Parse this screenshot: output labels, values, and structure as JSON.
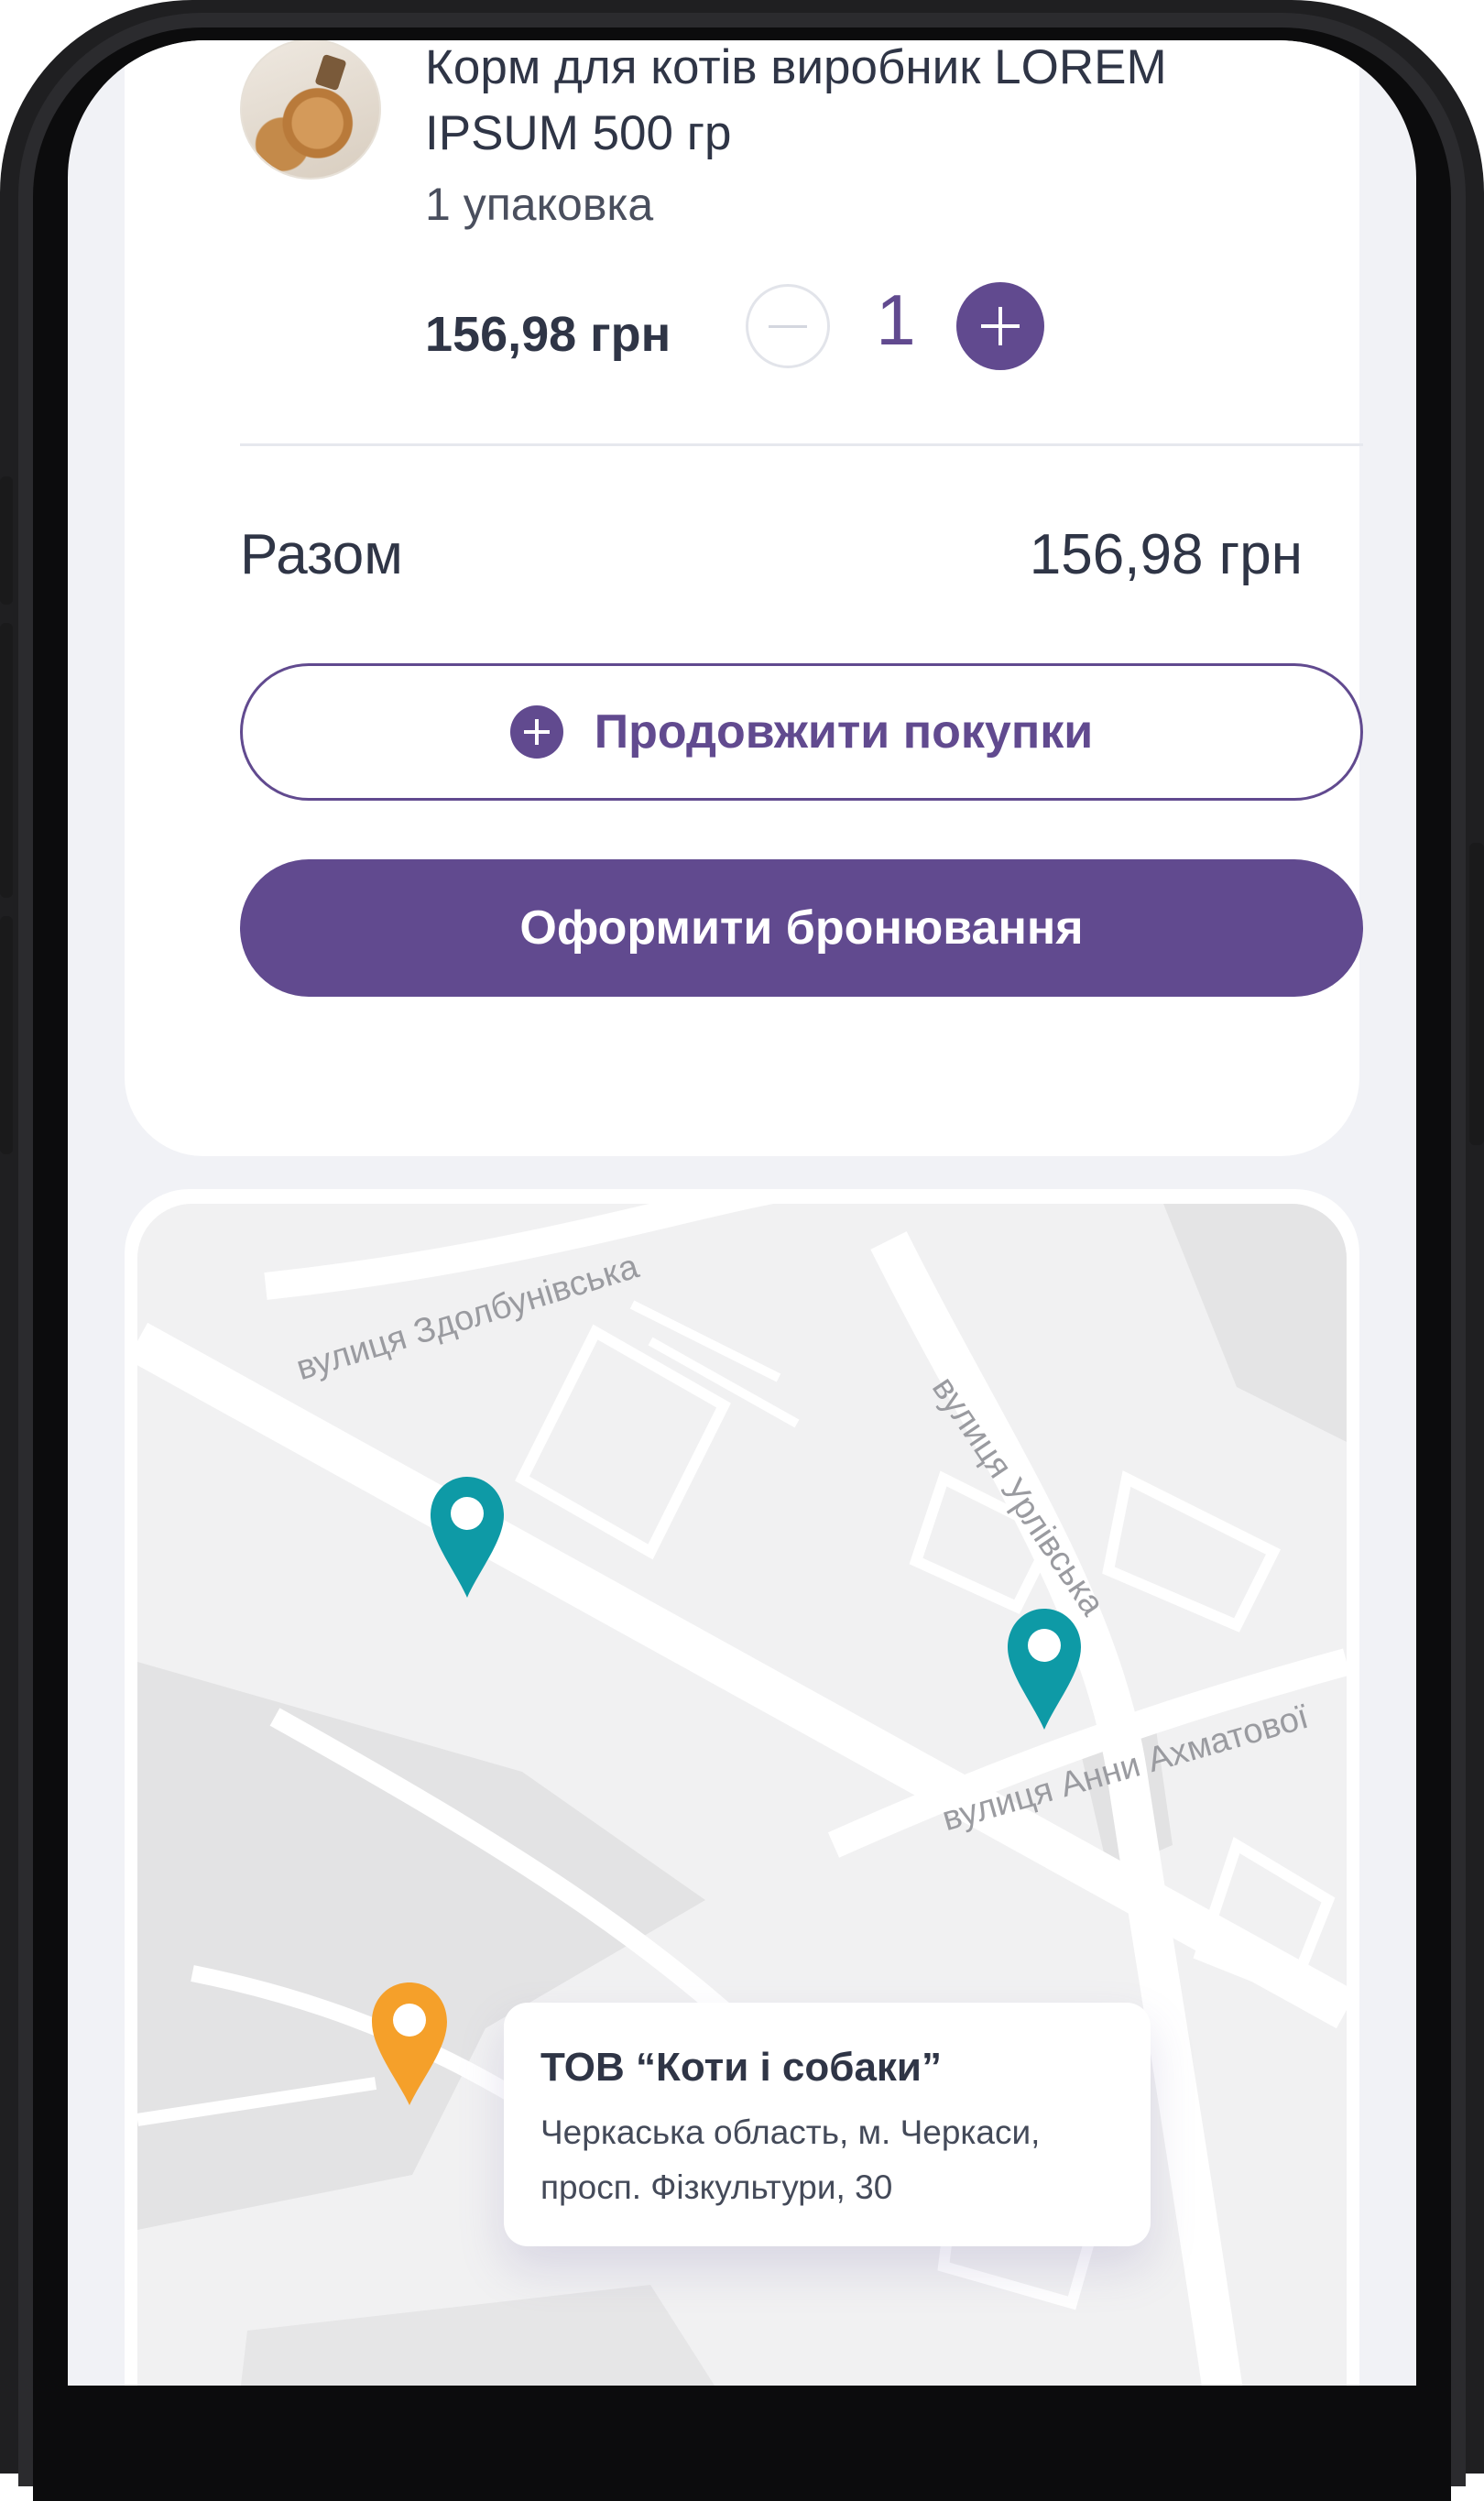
{
  "product": {
    "name": "Корм для котів виробник LOREM IPSUM 500 гр",
    "pack": "1 упаковка",
    "price": "156,98 грн",
    "quantity": "1"
  },
  "summary": {
    "total_label": "Разом",
    "total_value": "156,98 грн"
  },
  "actions": {
    "continue_label": "Продовжити покупки",
    "checkout_label": "Оформити бронювання"
  },
  "map": {
    "streets": [
      "вулиця Здолбунівська",
      "вулиця Урлівська",
      "вулиця Анни Ахматової"
    ],
    "store": {
      "title": "ТОВ “Коти і собаки”",
      "address": "Черкаська область, м. Черкаси, просп. Фізкультури, 30"
    },
    "colors": {
      "pin_teal": "#0e9aa6",
      "pin_orange": "#f5a02a",
      "accent": "#614a8f"
    }
  }
}
